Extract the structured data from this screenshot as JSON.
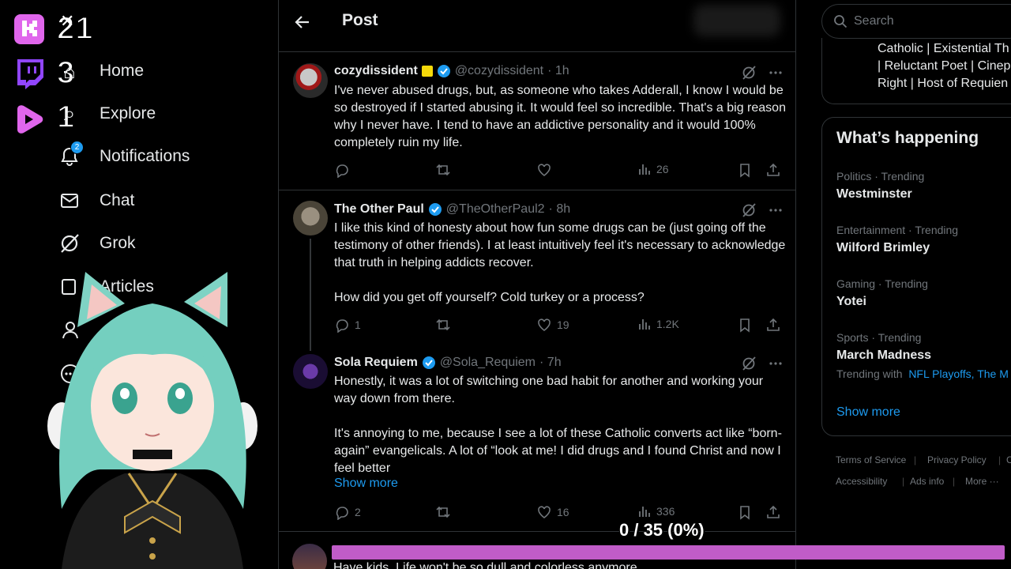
{
  "stream_overlay": {
    "kick_count": "21",
    "twitch_count": "3",
    "youtube_count": "1",
    "progress_label": "0 / 35 (0%)",
    "progress_fraction": 0,
    "colors": {
      "kick": "#e066ec",
      "twitch": "#9146ff",
      "youtube": "#e066ec",
      "progress_bar": "#c05cc8"
    }
  },
  "nav": {
    "items": [
      {
        "label": "Home",
        "icon": "home-icon"
      },
      {
        "label": "Explore",
        "icon": "search-icon"
      },
      {
        "label": "Notifications",
        "icon": "bell-icon",
        "badge": "2"
      },
      {
        "label": "Chat",
        "icon": "mail-icon"
      },
      {
        "label": "Grok",
        "icon": "grok-icon"
      },
      {
        "label": "Articles",
        "icon": "articles-icon"
      }
    ]
  },
  "header": {
    "title": "Post"
  },
  "tweets": [
    {
      "name": "cozydissident",
      "handle": "@cozydissident",
      "time": "· 1h",
      "text": "I've never abused drugs, but, as someone who takes Adderall, I know I would be so destroyed if I started abusing it. It would feel so incredible. That's a big reason why I never have. I tend to have an addictive personality and it would 100% completely ruin my life.",
      "replies": "",
      "retweets": "",
      "likes": "",
      "views": "26"
    },
    {
      "name": "The Other Paul",
      "handle": "@TheOtherPaul2",
      "time": "· 8h",
      "text": "I like this kind of honesty about how fun some drugs can be (just going off the testimony of other friends). I at least intuitively feel it's necessary to acknowledge that truth in helping addicts recover.\n\nHow did you get off yourself? Cold turkey or a process?",
      "replies": "1",
      "retweets": "",
      "likes": "19",
      "views": "1.2K"
    },
    {
      "name": "Sola Requiem",
      "handle": "@Sola_Requiem",
      "time": "· 7h",
      "text": "Honestly, it was a lot of switching one bad habit for another and working your way down from there.\n\nIt's annoying to me, because I see a lot of these Catholic converts act like “born-again” evangelicals. A lot of “look at me! I did drugs and I found Christ and now I feel better",
      "show_more": "Show more",
      "replies": "2",
      "retweets": "",
      "likes": "16",
      "views": "336"
    }
  ],
  "next_tweet_peek": "Have kids. Life won't be so dull and colorless anymore.",
  "right": {
    "search_placeholder": "Search",
    "bio_lines": [
      "Catholic | Existential Th",
      "| Reluctant Poet | Cinep",
      "Right | Host of Requien"
    ],
    "happening_title": "What’s happening",
    "trends": [
      {
        "category": "Politics · Trending",
        "name": "Westminster"
      },
      {
        "category": "Entertainment · Trending",
        "name": "Wilford Brimley"
      },
      {
        "category": "Gaming · Trending",
        "name": "Yotei"
      },
      {
        "category": "Sports · Trending",
        "name": "March Madness",
        "with_prefix": "Trending with",
        "with_links": "NFL Playoffs, The M"
      }
    ],
    "show_more": "Show more",
    "footer": [
      "Terms of Service",
      "Privacy Policy",
      "C",
      "Accessibility",
      "Ads info",
      "More ···"
    ]
  }
}
